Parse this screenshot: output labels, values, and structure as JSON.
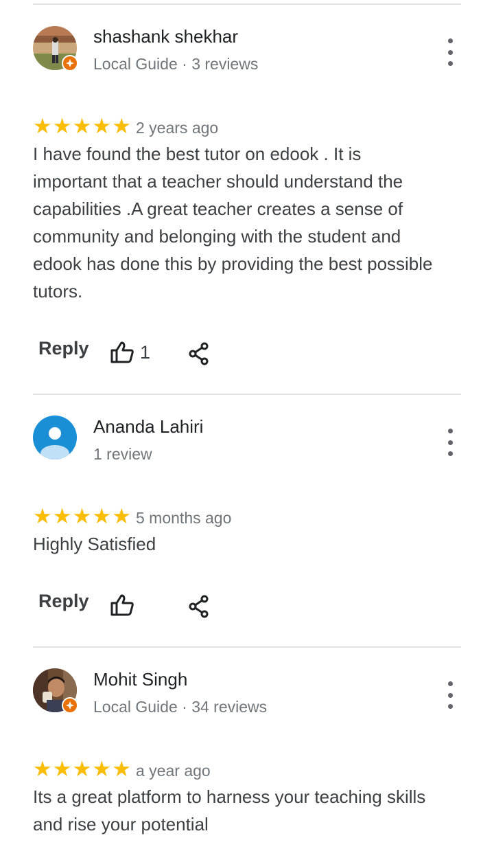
{
  "reviews": [
    {
      "name": "shashank shekhar",
      "subtitle": "Local Guide · 3 reviews",
      "rating": 5,
      "stars": [
        "★",
        "★",
        "★",
        "★",
        "★"
      ],
      "time": "2 years ago",
      "text": "I have found the best tutor on edook . It is important that a teacher should understand the capabilities .A great teacher creates a sense of community and belonging with the student  and edook has done this by providing the best possible tutors.",
      "reply_label": "Reply",
      "like_count": "1",
      "local_guide": true
    },
    {
      "name": "Ananda Lahiri",
      "subtitle": "1 review",
      "rating": 5,
      "stars": [
        "★",
        "★",
        "★",
        "★",
        "★"
      ],
      "time": "5 months ago",
      "text": "Highly Satisfied",
      "reply_label": "Reply",
      "like_count": "",
      "local_guide": false
    },
    {
      "name": "Mohit Singh",
      "subtitle": "Local Guide · 34 reviews",
      "rating": 5,
      "stars": [
        "★",
        "★",
        "★",
        "★",
        "★"
      ],
      "time": "a year ago",
      "text": "Its a great platform to harness your teaching skills and rise your potential",
      "reply_label": "Reply",
      "like_count": "",
      "local_guide": true
    }
  ],
  "colors": {
    "star": "#fbbc04",
    "local_guide_badge": "#e8710a",
    "default_avatar": "#1a8fd6"
  }
}
